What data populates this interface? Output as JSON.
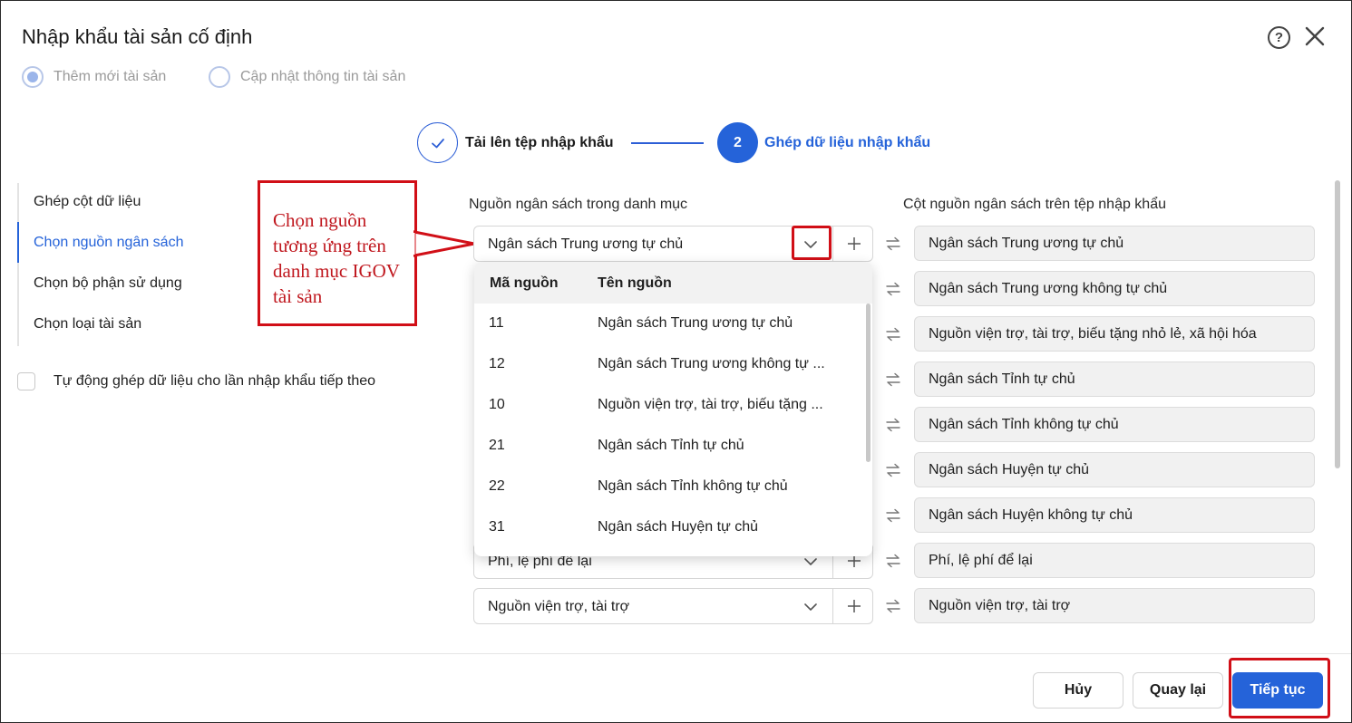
{
  "dialog": {
    "title": "Nhập khẩu tài sản cố định",
    "help_icon": "question-circle-icon",
    "close_icon": "close-icon"
  },
  "mode": {
    "options": [
      {
        "label": "Thêm mới tài sản",
        "selected": true
      },
      {
        "label": "Cập nhật thông tin tài sản",
        "selected": false
      }
    ]
  },
  "steps": [
    {
      "label": "Tải lên tệp nhập khẩu",
      "status": "done"
    },
    {
      "number": "2",
      "label": "Ghép dữ liệu nhập khẩu",
      "status": "active"
    }
  ],
  "left_nav": {
    "items": [
      {
        "label": "Ghép cột dữ liệu",
        "active": false
      },
      {
        "label": "Chọn nguồn ngân sách",
        "active": true
      },
      {
        "label": "Chọn bộ phận sử dụng",
        "active": false
      },
      {
        "label": "Chọn loại tài sản",
        "active": false
      }
    ]
  },
  "auto_match": {
    "label": "Tự động ghép dữ liệu cho lần nhập khẩu tiếp theo",
    "checked": false
  },
  "annotation": {
    "text": "Chọn nguồn tương ứng trên danh mục IGOV tài sản"
  },
  "mapping": {
    "left_header": "Nguồn ngân sách trong danh mục",
    "right_header": "Cột nguồn ngân sách trên tệp nhập khẩu",
    "selects": [
      {
        "value": "Ngân sách Trung ương tự chủ"
      },
      {
        "value": "Phí, lệ phí để lại"
      },
      {
        "value": "Nguồn viện trợ, tài trợ"
      }
    ],
    "targets": [
      "Ngân sách Trung ương tự chủ",
      "Ngân sách Trung ương không tự chủ",
      "Nguồn viện trợ, tài trợ, biếu tặng nhỏ lẻ, xã hội hóa",
      "Ngân sách Tỉnh tự chủ",
      "Ngân sách Tỉnh không tự chủ",
      "Ngân sách Huyện tự chủ",
      "Ngân sách Huyện không tự chủ",
      "Phí, lệ phí để lại",
      "Nguồn viện trợ, tài trợ"
    ]
  },
  "dropdown": {
    "columns": [
      "Mã nguồn",
      "Tên nguồn"
    ],
    "rows": [
      {
        "code": "11",
        "name": "Ngân sách Trung ương tự chủ"
      },
      {
        "code": "12",
        "name": "Ngân sách Trung ương không tự ..."
      },
      {
        "code": "10",
        "name": "Nguồn viện trợ, tài trợ, biếu tặng ..."
      },
      {
        "code": "21",
        "name": "Ngân sách Tỉnh tự chủ"
      },
      {
        "code": "22",
        "name": "Ngân sách Tỉnh không tự chủ"
      },
      {
        "code": "31",
        "name": "Ngân sách Huyện tự chủ"
      }
    ]
  },
  "footer": {
    "cancel_label": "Hủy",
    "back_label": "Quay lại",
    "next_label": "Tiếp tục"
  },
  "colors": {
    "accent": "#2563d9",
    "annotation": "#d10f17"
  }
}
